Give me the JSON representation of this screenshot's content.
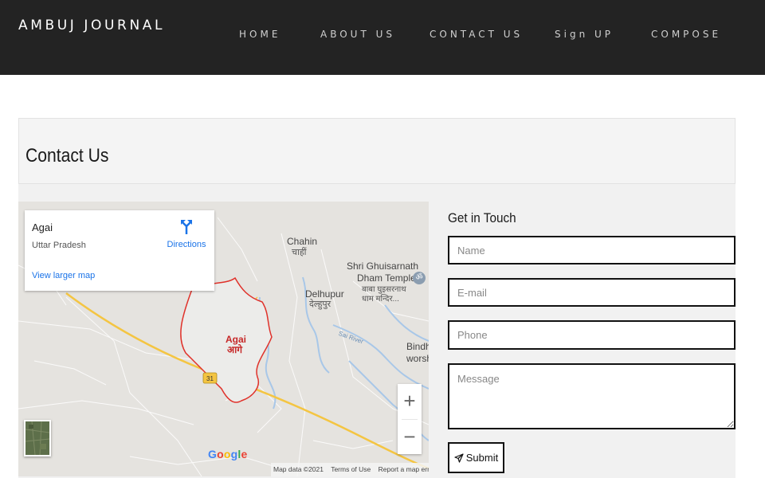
{
  "brand": "AMBUJ JOURNAL",
  "nav": [
    {
      "label": "HOME"
    },
    {
      "label": "ABOUT US"
    },
    {
      "label": "CONTACT US"
    },
    {
      "label": "Sign UP"
    },
    {
      "label": "COMPOSE"
    }
  ],
  "page": {
    "title": "Contact Us"
  },
  "map": {
    "place": "Agai",
    "region": "Uttar Pradesh",
    "directions_label": "Directions",
    "larger_map_label": "View larger map",
    "labels": {
      "chahin_en": "Chahin",
      "chahin_hi": "चाहीं",
      "temple_1": "Shri Ghuisarnath",
      "temple_2": "Dham Temple",
      "temple_hi_1": "बाबा घुइसरनाथ",
      "temple_hi_2": "धाम मन्दिर...",
      "delhupur_en": "Delhupur",
      "delhupur_hi": "देल्हुपुर",
      "sai_river": "Sai River",
      "agai_en": "Agai",
      "agai_hi": "आगे",
      "bindh_1": "Bindh",
      "bindh_2": "worsh",
      "route": "31"
    },
    "zoom_in": "+",
    "zoom_out": "−",
    "google": "Google",
    "attribution": {
      "data": "Map data ©2021",
      "terms": "Terms of Use",
      "report": "Report a map error"
    },
    "colors": {
      "boundary": "#e0312a",
      "road": "#f4c542",
      "river": "#a8c7e8",
      "land": "#e5e3df"
    }
  },
  "form": {
    "title": "Get in Touch",
    "name_placeholder": "Name",
    "email_placeholder": "E-mail",
    "phone_placeholder": "Phone",
    "message_placeholder": "Message",
    "submit_label": "Submit"
  }
}
